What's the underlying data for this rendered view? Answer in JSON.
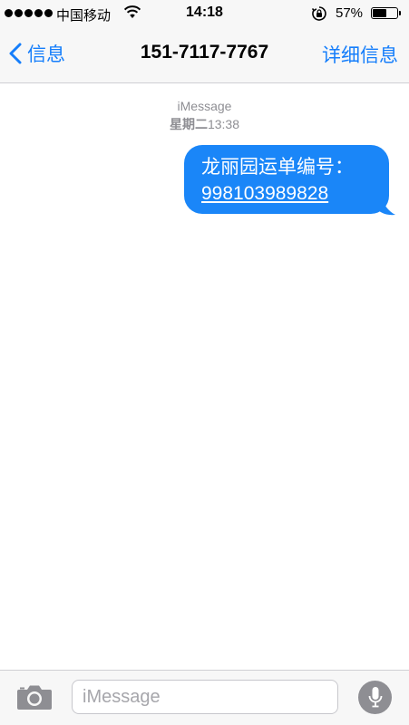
{
  "status_bar": {
    "carrier": "中国移动",
    "time": "14:18",
    "battery_percent_label": "57%",
    "battery_level": 0.57,
    "signal_bars": 5,
    "icons": [
      "signal-dots-icon",
      "wifi-icon",
      "rotation-lock-icon",
      "battery-icon"
    ]
  },
  "nav": {
    "back_label": "信息",
    "title": "151-7117-7767",
    "details_label": "详细信息",
    "back_icon": "chevron-left-icon"
  },
  "conversation": {
    "service": "iMessage",
    "timestamp_day": "星期二",
    "timestamp_time": "13:38",
    "messages": [
      {
        "direction": "outgoing",
        "text": "龙丽园运单编号：",
        "link": "998103989828"
      }
    ]
  },
  "composer": {
    "placeholder": "iMessage",
    "value": "",
    "camera_icon": "camera-icon",
    "mic_icon": "microphone-icon"
  },
  "colors": {
    "accent": "#157efb",
    "bubble_outgoing": "#1a86f8",
    "bar_background": "#f7f7f7",
    "secondary_text": "#8e8e93"
  }
}
